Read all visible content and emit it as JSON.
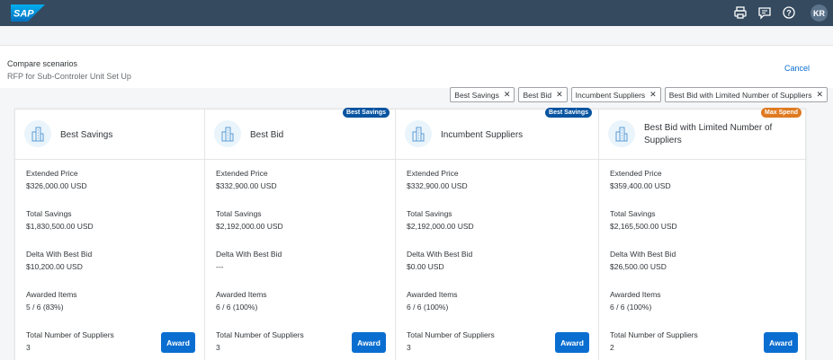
{
  "shell": {
    "logo_text": "SAP",
    "avatar_initials": "KR"
  },
  "header": {
    "title": "Compare scenarios",
    "subtitle": "RFP for Sub-Controler Unit Set Up",
    "cancel_label": "Cancel"
  },
  "filter_tokens": [
    {
      "label": "Best Savings"
    },
    {
      "label": "Best Bid"
    },
    {
      "label": "Incumbent Suppliers"
    },
    {
      "label": "Best Bid with Limited Number of Suppliers"
    }
  ],
  "columns": [
    {
      "title": "Best Savings",
      "badge": "",
      "extended_price_label": "Extended Price",
      "extended_price": "$326,000.00 USD",
      "total_savings_label": "Total Savings",
      "total_savings": "$1,830,500.00 USD",
      "delta_label": "Delta With Best Bid",
      "delta": "$10,200.00 USD",
      "awarded_label": "Awarded Items",
      "awarded": "5 / 6 (83%)",
      "suppliers_label": "Total Number of Suppliers",
      "suppliers": "3",
      "award_label": "Award"
    },
    {
      "title": "Best Bid",
      "badge": "Best Savings",
      "extended_price_label": "Extended Price",
      "extended_price": "$332,900.00 USD",
      "total_savings_label": "Total Savings",
      "total_savings": "$2,192,000.00 USD",
      "delta_label": "Delta With Best Bid",
      "delta": "---",
      "awarded_label": "Awarded Items",
      "awarded": "6 / 6 (100%)",
      "suppliers_label": "Total Number of Suppliers",
      "suppliers": "3",
      "award_label": "Award"
    },
    {
      "title": "Incumbent Suppliers",
      "badge": "Best Savings",
      "extended_price_label": "Extended Price",
      "extended_price": "$332,900.00 USD",
      "total_savings_label": "Total Savings",
      "total_savings": "$2,192,000.00 USD",
      "delta_label": "Delta With Best Bid",
      "delta": "$0.00 USD",
      "awarded_label": "Awarded Items",
      "awarded": "6 / 6 (100%)",
      "suppliers_label": "Total Number of Suppliers",
      "suppliers": "3",
      "award_label": "Award"
    },
    {
      "title": "Best Bid with Limited Number of Suppliers",
      "badge": "Max Spend",
      "extended_price_label": "Extended Price",
      "extended_price": "$359,400.00 USD",
      "total_savings_label": "Total Savings",
      "total_savings": "$2,165,500.00 USD",
      "delta_label": "Delta With Best Bid",
      "delta": "$26,500.00 USD",
      "awarded_label": "Awarded Items",
      "awarded": "6 / 6 (100%)",
      "suppliers_label": "Total Number of Suppliers",
      "suppliers": "2",
      "award_label": "Award"
    }
  ],
  "colors": {
    "shell_bg": "#354a5f",
    "accent": "#0a6ed1",
    "badge_savings": "#0854a0",
    "badge_max_spend": "#df7a20"
  }
}
